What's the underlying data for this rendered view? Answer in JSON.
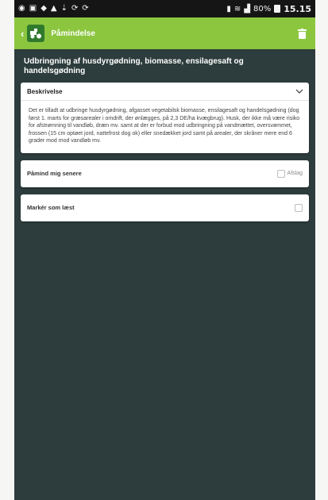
{
  "status_bar": {
    "time": "15.15",
    "battery": "80%",
    "left_icons": [
      "location-icon",
      "image-icon",
      "shield-icon",
      "warning-icon",
      "download-icon",
      "sync-icon",
      "sync-icon"
    ],
    "right_icons": [
      "vibrate-icon",
      "wifi-icon",
      "signal-icon"
    ]
  },
  "app_bar": {
    "title": "Påmindelse",
    "accent_color": "#8cc63f",
    "logo_color": "#2f7a2c"
  },
  "task": {
    "title": "Udbringning af husdyrgødning, biomasse, ensilagesaft og handelsgødning"
  },
  "description_card": {
    "header": "Beskrivelse",
    "body": "Det er tilladt at udbringe husdyrgødning, afgasset vegetabilsk biomasse, ensilagesaft og handelsgødning (dog først 1. marts for græsarealer i omdrift, der ønlægges, på 2,3 DE/ha kvægbrug). Husk, der ikke må være risiko for afstrømning til vandløb, dræn mv. samt at der er forbud mod udbringning på vandmættet, oversvømmet, frossen (15 cm optøet jord, nattefrost dog ok) eller snedækket jord samt på arealer, der skråner mere end 6 grader mod mod vandløb mv."
  },
  "remind_row": {
    "label": "Påmind mig senere",
    "action": "Afslag"
  },
  "done_row": {
    "label": "Markér som læst"
  }
}
